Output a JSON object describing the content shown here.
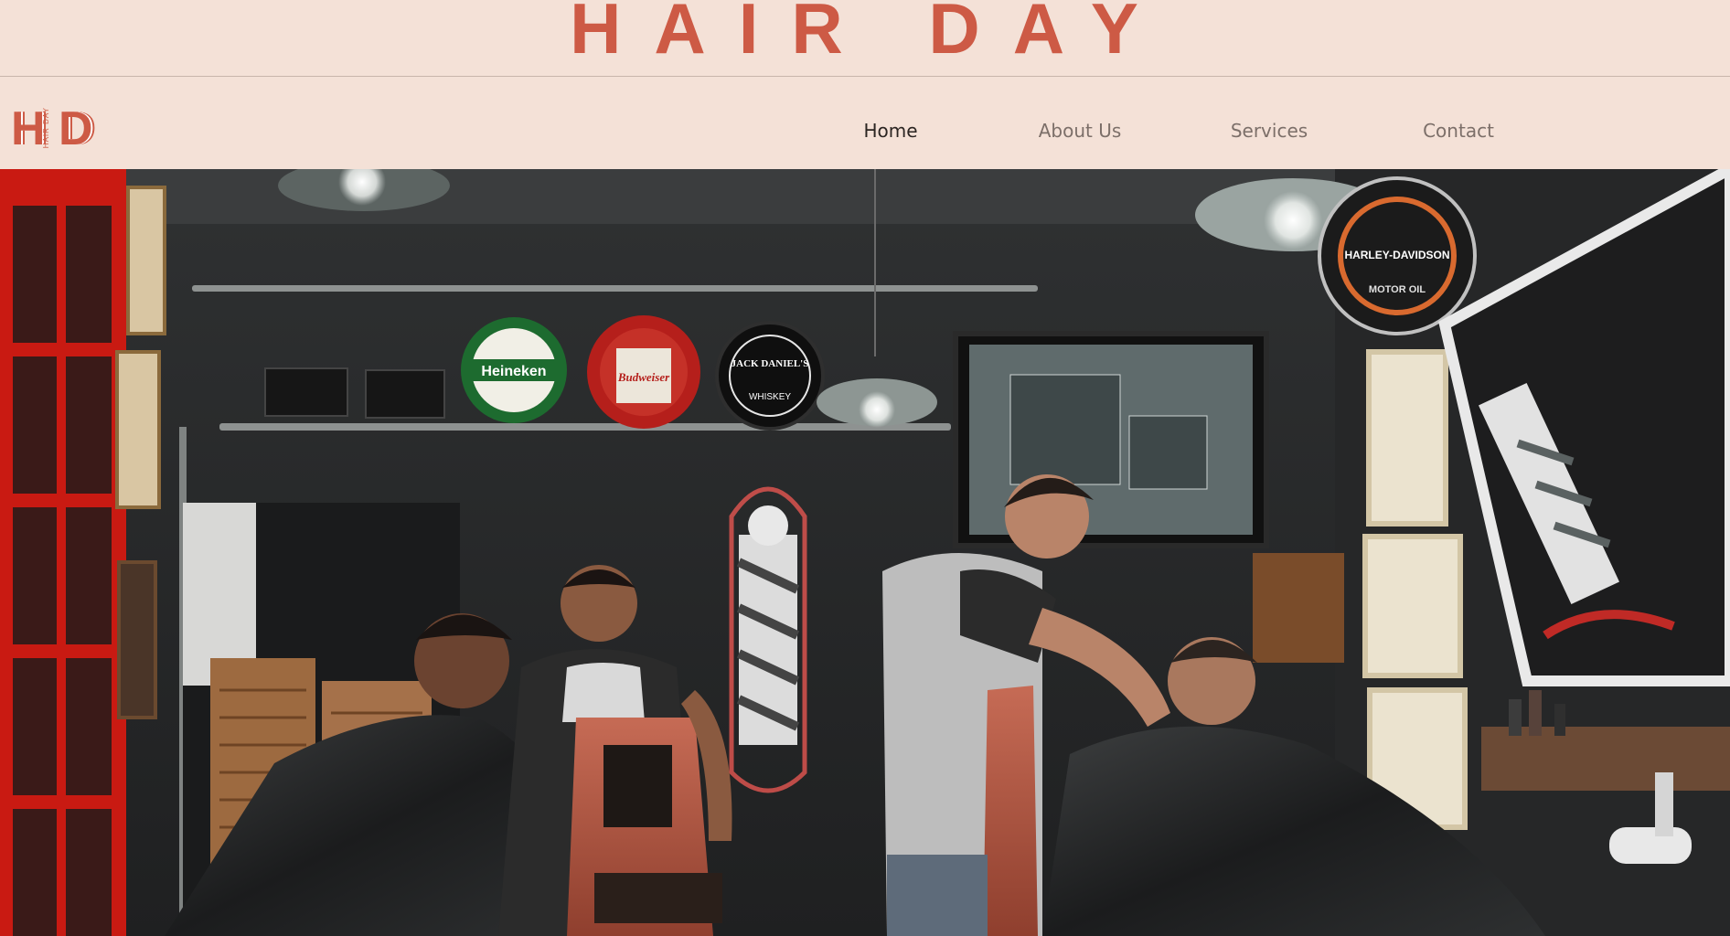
{
  "banner": {
    "title": "HAIR DAY"
  },
  "logo": {
    "letter_left": "H",
    "letter_right": "D",
    "tagline": "HAIR DAY"
  },
  "nav": {
    "items": [
      {
        "label": "Home",
        "active": true
      },
      {
        "label": "About Us",
        "active": false
      },
      {
        "label": "Services",
        "active": false
      },
      {
        "label": "Contact",
        "active": false
      }
    ]
  },
  "hero": {
    "signs": {
      "heineken": "Heineken",
      "budweiser": "Budweiser",
      "jack_daniels": "JACK DANIEL'S",
      "jack_daniels_sub": "WHISKEY",
      "harley": "HARLEY-DAVIDSON",
      "harley_sub": "MOTOR OIL"
    }
  },
  "colors": {
    "accent": "#cd5a45",
    "background": "#f4e1d7",
    "nav_text": "#7c6f69",
    "nav_active": "#2b2522"
  }
}
